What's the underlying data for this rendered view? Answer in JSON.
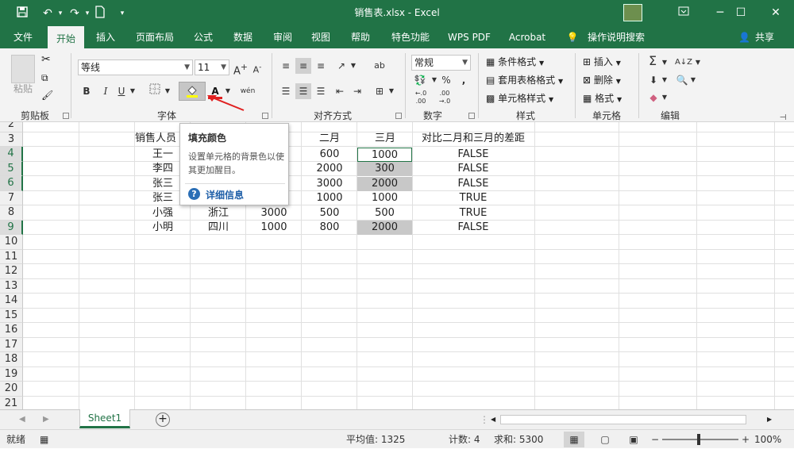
{
  "window": {
    "title": "销售表.xlsx - Excel"
  },
  "ribbon_tabs": [
    "文件",
    "开始",
    "插入",
    "页面布局",
    "公式",
    "数据",
    "审阅",
    "视图",
    "帮助",
    "特色功能",
    "WPS PDF",
    "Acrobat",
    "操作说明搜索"
  ],
  "share_label": "共享",
  "clipboard": {
    "paste": "粘贴",
    "group": "剪贴板"
  },
  "font": {
    "name": "等线",
    "size": "11",
    "bold": "B",
    "italic": "I",
    "underline": "U",
    "color_glyph": "A",
    "pinyin": "wén",
    "group": "字体"
  },
  "align": {
    "group": "对齐方式",
    "wrap": "ab"
  },
  "number": {
    "format": "常规",
    "pct": "%",
    "comma": ",",
    "dec_inc": "←.0 .00",
    "dec_dec": ".00 →.0",
    "group": "数字"
  },
  "styles": {
    "cond": "条件格式",
    "table": "套用表格格式",
    "cell": "单元格样式",
    "group": "样式"
  },
  "cells": {
    "insert": "插入",
    "delete": "删除",
    "format": "格式",
    "group": "单元格"
  },
  "editing": {
    "sum": "Σ",
    "sort": "A↓Z",
    "group": "编辑"
  },
  "tooltip": {
    "title": "填充颜色",
    "desc": "设置单元格的背景色以使其更加醒目。",
    "more": "详细信息"
  },
  "grid": {
    "row_numbers": [
      "2",
      "3",
      "4",
      "5",
      "6",
      "7",
      "8",
      "9",
      "10",
      "11",
      "12",
      "13",
      "14",
      "15",
      "16",
      "17",
      "18",
      "19",
      "20",
      "21"
    ],
    "header_row": {
      "name": "销售人员",
      "feb": "二月",
      "mar": "三月",
      "cmp": "对比二月和三月的差距"
    },
    "rows": [
      {
        "name": "王一",
        "region": "",
        "jan": "",
        "feb": "600",
        "mar": "1000",
        "cmp": "FALSE"
      },
      {
        "name": "李四",
        "region": "",
        "jan": "",
        "feb": "2000",
        "mar": "300",
        "cmp": "FALSE"
      },
      {
        "name": "张三",
        "region": "",
        "jan": "",
        "feb": "3000",
        "mar": "2000",
        "cmp": "FALSE"
      },
      {
        "name": "张三",
        "region": "",
        "jan": "",
        "feb": "1000",
        "mar": "1000",
        "cmp": "TRUE"
      },
      {
        "name": "小强",
        "region": "浙江",
        "jan": "3000",
        "feb": "500",
        "mar": "500",
        "cmp": "TRUE"
      },
      {
        "name": "小明",
        "region": "四川",
        "jan": "1000",
        "feb": "800",
        "mar": "2000",
        "cmp": "FALSE"
      }
    ]
  },
  "sheet": {
    "tab": "Sheet1",
    "add": "+"
  },
  "status": {
    "ready": "就绪",
    "average": "平均值: 1325",
    "count": "计数: 4",
    "sum": "求和: 5300",
    "zoom": "100%"
  },
  "colors": {
    "accent": "#217346",
    "selection_fill": "#c8c8c8"
  }
}
